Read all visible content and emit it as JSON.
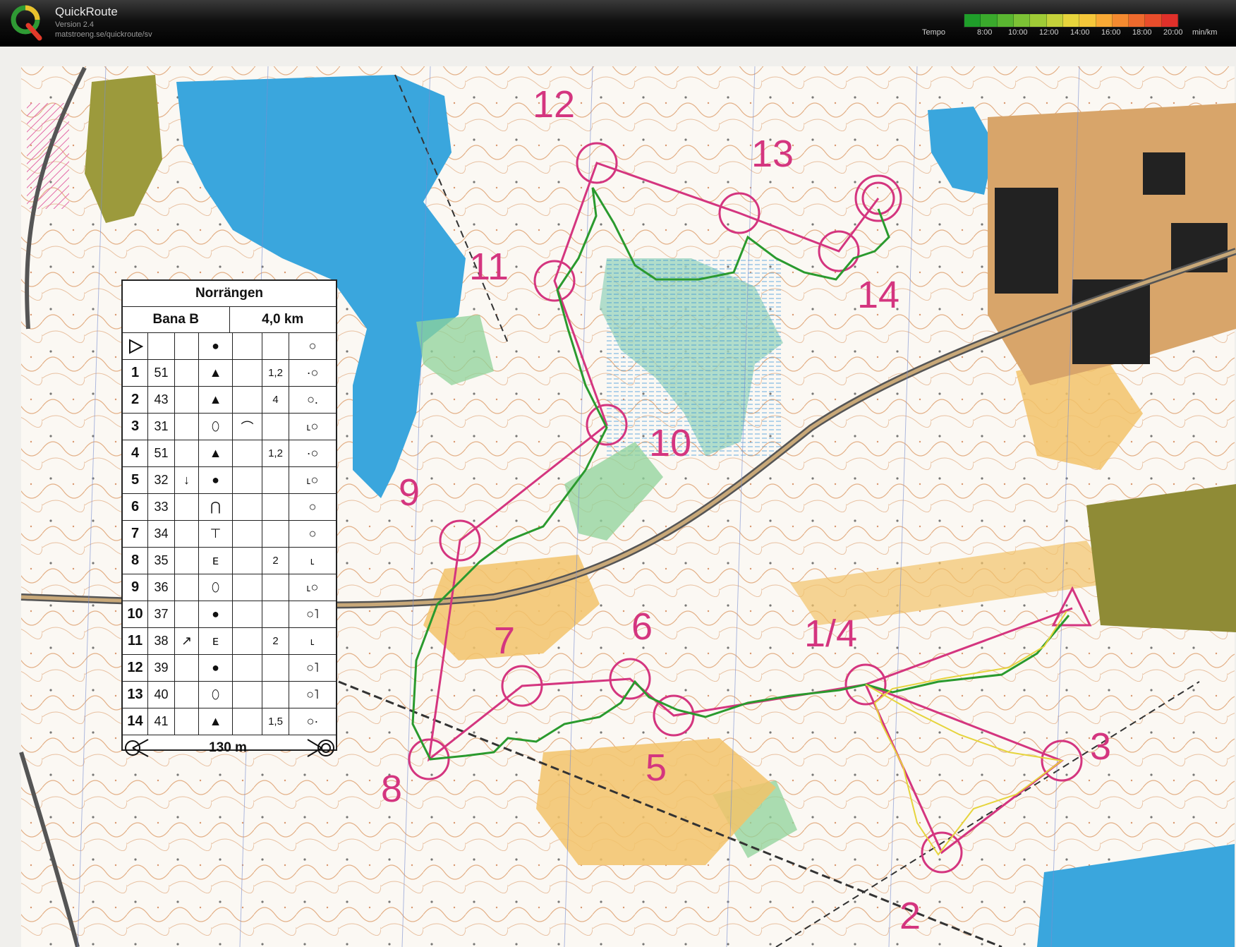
{
  "app": {
    "name": "QuickRoute",
    "version": "Version 2.4",
    "url": "matstroeng.se/quickroute/sv",
    "logo_letter": "Q"
  },
  "tempo": {
    "label": "Tempo",
    "ticks": [
      "8:00",
      "10:00",
      "12:00",
      "14:00",
      "16:00",
      "18:00",
      "20:00"
    ],
    "unit": "min/km",
    "scale_colors": [
      "#1f9e2a",
      "#3aaa2c",
      "#5ab631",
      "#7cc235",
      "#9fcb36",
      "#c4d13a",
      "#e6d43c",
      "#f5c73a",
      "#f8a935",
      "#f48a30",
      "#ee6a2d",
      "#e84d2b",
      "#e0302a"
    ]
  },
  "map": {
    "course_color": "#d4357f",
    "route_color_slow": "#e6d43c",
    "route_color_fast": "#1f9e2a",
    "controls": [
      {
        "label": "1/4"
      },
      {
        "label": "2"
      },
      {
        "label": "3"
      },
      {
        "label": "5"
      },
      {
        "label": "6"
      },
      {
        "label": "7"
      },
      {
        "label": "8"
      },
      {
        "label": "9"
      },
      {
        "label": "10"
      },
      {
        "label": "11"
      },
      {
        "label": "12"
      },
      {
        "label": "13"
      },
      {
        "label": "14"
      }
    ]
  },
  "description_sheet": {
    "event": "Norrängen",
    "course": "Bana B",
    "length": "4,0 km",
    "start_symbol": "start-triangle",
    "rows": [
      {
        "num": "1",
        "code": "51",
        "dir": "",
        "feature": "▲",
        "appearance": "",
        "dim": "1,2",
        "location": "·○"
      },
      {
        "num": "2",
        "code": "43",
        "dir": "",
        "feature": "▲",
        "appearance": "",
        "dim": "4",
        "location": "○."
      },
      {
        "num": "3",
        "code": "31",
        "dir": "",
        "feature": "⬯",
        "appearance": "⌒",
        "dim": "",
        "location": "˪○"
      },
      {
        "num": "4",
        "code": "51",
        "dir": "",
        "feature": "▲",
        "appearance": "",
        "dim": "1,2",
        "location": "·○"
      },
      {
        "num": "5",
        "code": "32",
        "dir": "↓",
        "feature": "●",
        "appearance": "",
        "dim": "",
        "location": "˪○"
      },
      {
        "num": "6",
        "code": "33",
        "dir": "",
        "feature": "⋂",
        "appearance": "",
        "dim": "",
        "location": "○"
      },
      {
        "num": "7",
        "code": "34",
        "dir": "",
        "feature": "⊤",
        "appearance": "",
        "dim": "",
        "location": "○"
      },
      {
        "num": "8",
        "code": "35",
        "dir": "",
        "feature": "ᴇ",
        "appearance": "",
        "dim": "2",
        "location": "˪"
      },
      {
        "num": "9",
        "code": "36",
        "dir": "",
        "feature": "⬯",
        "appearance": "",
        "dim": "",
        "location": "˪○"
      },
      {
        "num": "10",
        "code": "37",
        "dir": "",
        "feature": "●",
        "appearance": "",
        "dim": "",
        "location": "○˥"
      },
      {
        "num": "11",
        "code": "38",
        "dir": "↗",
        "feature": "ᴇ",
        "appearance": "",
        "dim": "2",
        "location": "˪"
      },
      {
        "num": "12",
        "code": "39",
        "dir": "",
        "feature": "●",
        "appearance": "",
        "dim": "",
        "location": "○˥"
      },
      {
        "num": "13",
        "code": "40",
        "dir": "",
        "feature": "⬯",
        "appearance": "",
        "dim": "",
        "location": "○˥"
      },
      {
        "num": "14",
        "code": "41",
        "dir": "",
        "feature": "▲",
        "appearance": "",
        "dim": "1,5",
        "location": "○·"
      }
    ],
    "finish_distance": "130 m"
  }
}
